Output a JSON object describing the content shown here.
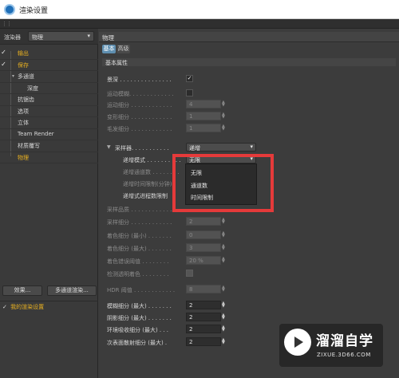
{
  "window": {
    "title": "渲染设置"
  },
  "left": {
    "renderer_label": "渲染器",
    "renderer_value": "物理",
    "tree": [
      {
        "label": "输出",
        "checked": true,
        "color": "yellow",
        "indent": 22
      },
      {
        "label": "保存",
        "checked": true,
        "color": "yellow",
        "indent": 22
      },
      {
        "label": "多通道",
        "checked": false,
        "color": "white",
        "indent": 22,
        "expander": "▾"
      },
      {
        "label": "深度",
        "checked": false,
        "color": "white",
        "indent": 34
      },
      {
        "label": "抗锯齿",
        "checked": false,
        "color": "white",
        "indent": 22
      },
      {
        "label": "选项",
        "checked": false,
        "color": "white",
        "indent": 22
      },
      {
        "label": "立体",
        "checked": false,
        "color": "white",
        "indent": 22
      },
      {
        "label": "Team Render",
        "checked": false,
        "color": "white",
        "indent": 22
      },
      {
        "label": "材质覆写",
        "checked": false,
        "color": "white",
        "indent": 22
      },
      {
        "label": "物理",
        "checked": false,
        "color": "yellow",
        "indent": 22
      }
    ],
    "effects_button": "效果...",
    "multipass_button": "多通道渲染...",
    "preset_label": "我的渲染设置"
  },
  "right": {
    "section_title": "物理",
    "tabs": [
      "基本",
      "高级"
    ],
    "group_title": "基本属性",
    "depth_of_field": {
      "label": "景深 . . . . . . . . . . . . . . .",
      "checked": true
    },
    "motion_blur": {
      "label": "运动模糊. . . . . . . . . . . . .",
      "checked": false
    },
    "motion_subdivision": {
      "label": "运动细分 . . . . . . . . . . . .",
      "value": "4"
    },
    "deform_subdivision": {
      "label": "变形细分 . . . . . . . . . . . .",
      "value": "1"
    },
    "hair_subdivision": {
      "label": "毛发细分 . . . . . . . . . . . .",
      "value": "1"
    },
    "sampler": {
      "label": "采样器. . . . . . . . . . .",
      "value": "递增"
    },
    "progressive_mode": {
      "label": "递增模式 . . . . . . . . . .",
      "value": "无限"
    },
    "progressive_passes": {
      "label": "递增通道数 . . . . . . . ."
    },
    "progressive_time": {
      "label": "递增时间限制(分钟)"
    },
    "progressive_cores": {
      "label": "递增式进程数限制"
    },
    "sampling_quality": {
      "label": "采样品质 . . . . . . . . . . . ."
    },
    "sampling_subdivision": {
      "label": "采样细分 . . . . . . . . . . . .",
      "value": "2"
    },
    "shading_min": {
      "label": "着色细分 (最小) . . . . . . .",
      "value": "0"
    },
    "shading_max": {
      "label": "着色细分 (最大) . . . . . . .",
      "value": "3"
    },
    "shading_threshold": {
      "label": "着色错误阈值 . . . . . . . .",
      "value": "20 %"
    },
    "detect_transparency": {
      "label": "检测透明着色 . . . . . . . .",
      "checked": false
    },
    "hdr_threshold": {
      "label": "HDR 阈值 . . . . . . . . . . . .",
      "value": "8"
    },
    "blur_max": {
      "label": "模糊细分 (最大) . . . . . . .",
      "value": "2"
    },
    "shadow_max": {
      "label": "阴影细分 (最大) . . . . . . .",
      "value": "2"
    },
    "ao_max": {
      "label": "环境吸收细分 (最大) . . .",
      "value": "2"
    },
    "sss_max": {
      "label": "次表面散射细分 (最大) .",
      "value": "2"
    },
    "dropdown_options": [
      "无限",
      "通道数",
      "时间限制"
    ]
  },
  "watermark": {
    "title": "溜溜自学",
    "subtitle": "ZIXUE.3D66.COM"
  },
  "colors": {
    "accent_tab": "#5f8fb0",
    "tree_active": "#e8b020",
    "highlight_box": "#e53a3a"
  }
}
